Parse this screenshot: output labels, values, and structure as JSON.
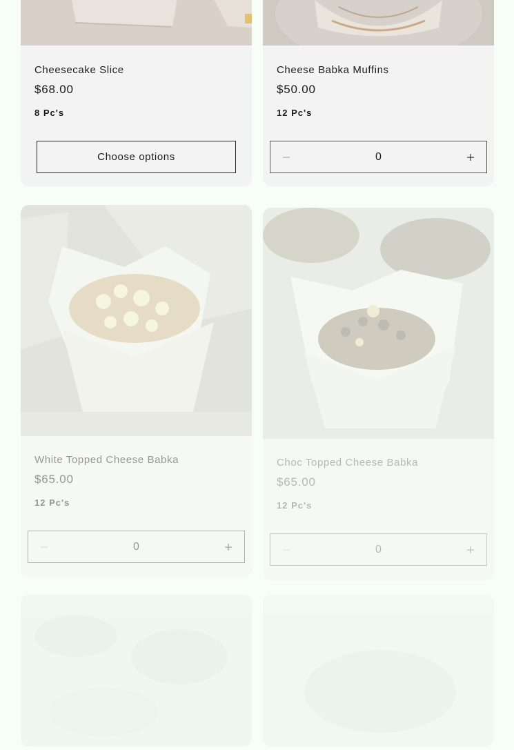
{
  "products": [
    {
      "name": "Cheesecake Slice",
      "price": "$68.00",
      "quantity_label": "8 Pc's",
      "action": "Choose options"
    },
    {
      "name": "Cheese Babka Muffins",
      "price": "$50.00",
      "quantity_label": "12 Pc's",
      "stepper_value": "0"
    },
    {
      "name": "White Topped Cheese Babka",
      "price": "$65.00",
      "quantity_label": "12 Pc's",
      "stepper_value": "0"
    },
    {
      "name": "Choc Topped Cheese Babka",
      "price": "$65.00",
      "quantity_label": "12 Pc's",
      "stepper_value": "0"
    }
  ],
  "icons": {
    "minus": "minus-icon",
    "plus": "plus-icon"
  }
}
